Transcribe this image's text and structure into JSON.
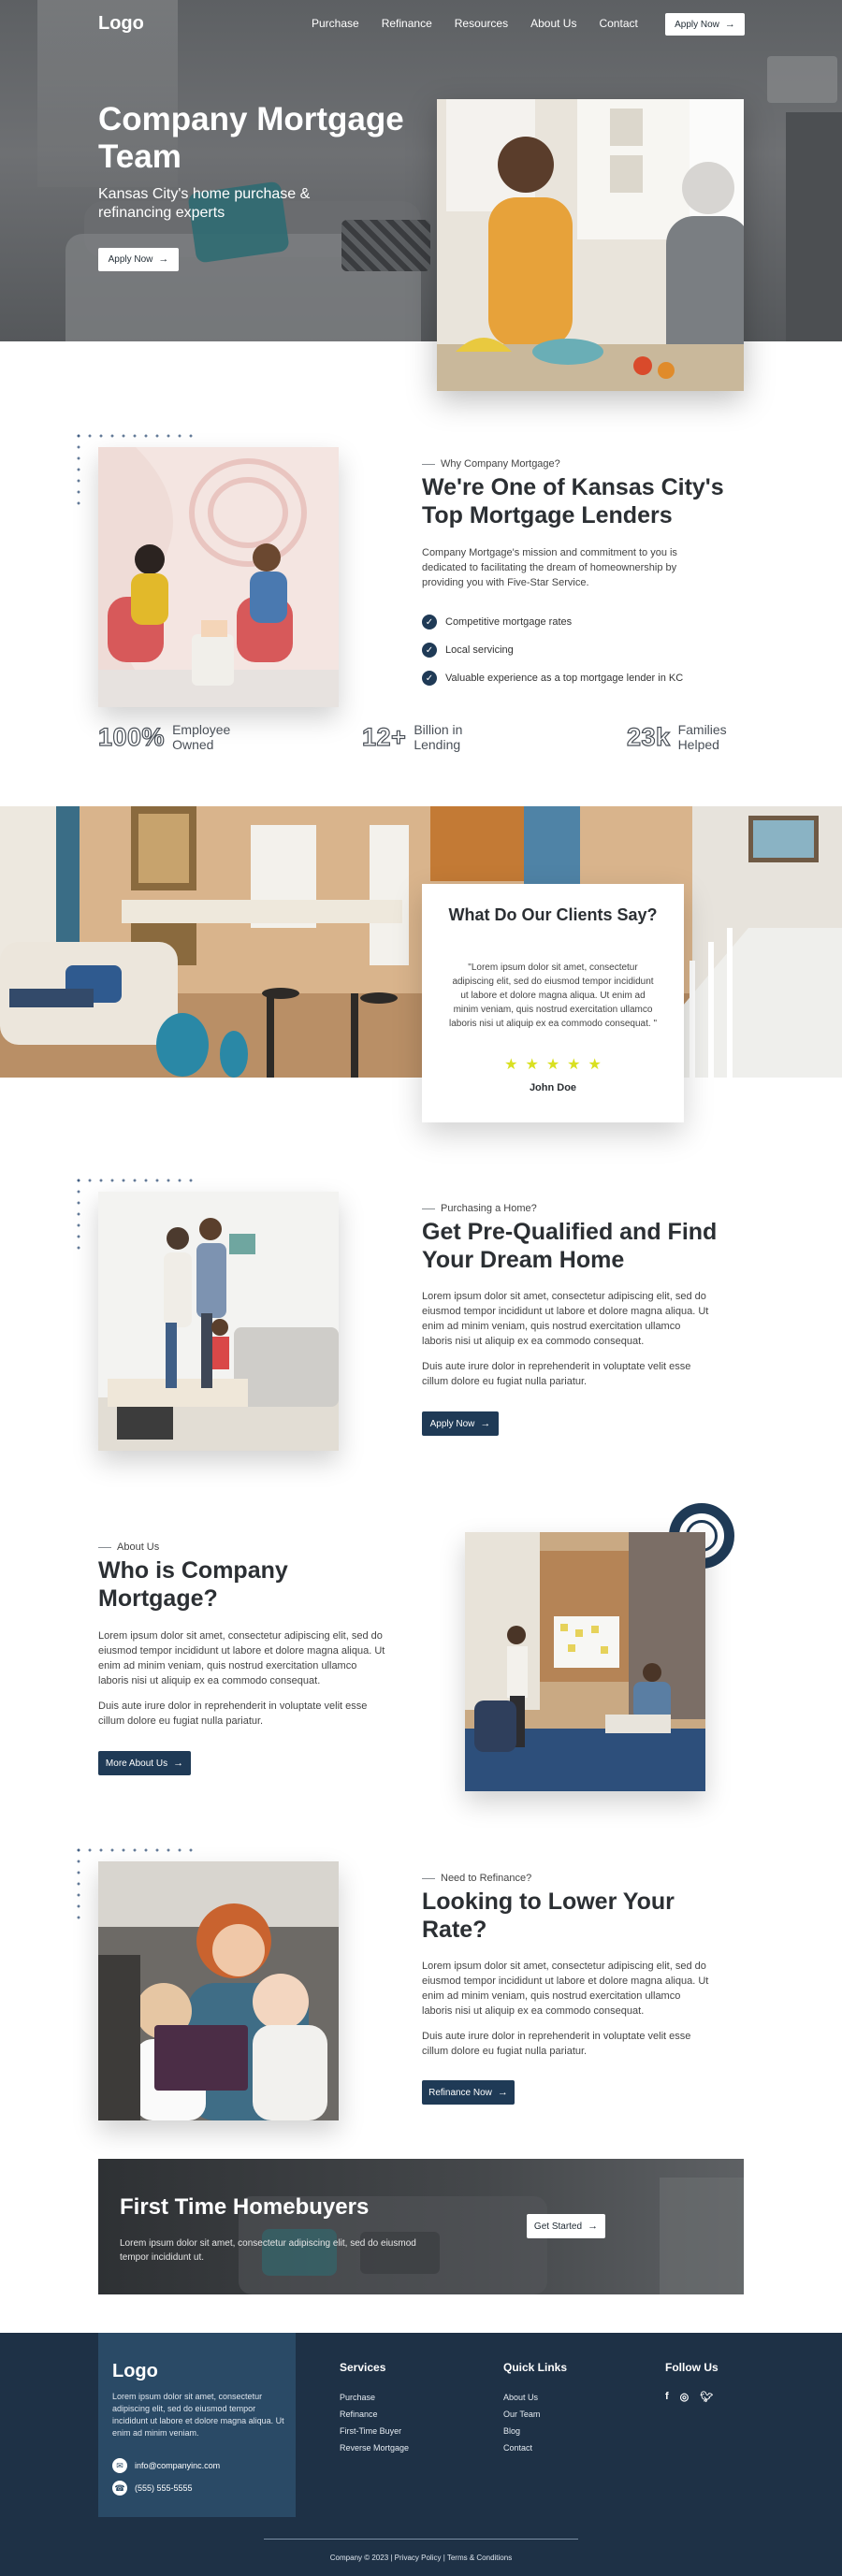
{
  "nav": {
    "logo": "Logo",
    "links": [
      "Purchase",
      "Refinance",
      "Resources",
      "About Us",
      "Contact"
    ],
    "apply_label": "Apply Now"
  },
  "hero": {
    "title": "Company Mortgage Team",
    "subtitle": "Kansas City's home purchase & refinancing experts",
    "button_label": "Apply Now"
  },
  "why": {
    "eyebrow": "Why Company Mortgage?",
    "title": "We're One of Kansas City's Top Mortgage Lenders",
    "text": "Company Mortgage's mission and commitment to you is dedicated to facilitating the dream of homeownership by providing you with Five-Star Service.",
    "checks": [
      "Competitive mortgage rates",
      "Local servicing",
      "Valuable experience as a top mortgage lender in KC"
    ]
  },
  "stats": [
    {
      "value": "100%",
      "label": "Employee Owned"
    },
    {
      "value": "12+",
      "label": "Billion in Lending"
    },
    {
      "value": "23k",
      "label": "Families Helped"
    }
  ],
  "testimonial": {
    "title": "What Do Our Clients Say?",
    "quote": "\"Lorem ipsum dolor sit amet, consectetur adipiscing elit, sed do eiusmod tempor incididunt ut labore et dolore magna aliqua. Ut enim ad minim veniam, quis nostrud exercitation ullamco laboris nisi ut aliquip ex ea commodo consequat. \"",
    "stars": 5,
    "name": "John Doe"
  },
  "prequal": {
    "eyebrow": "Purchasing a Home?",
    "title": "Get Pre-Qualified and Find Your Dream Home",
    "text1": "Lorem ipsum dolor sit amet, consectetur adipiscing elit, sed do eiusmod tempor incididunt ut labore et dolore magna aliqua. Ut enim ad minim veniam, quis nostrud exercitation ullamco laboris nisi ut aliquip ex ea commodo consequat.",
    "text2": "Duis aute irure dolor in reprehenderit in voluptate velit esse cillum dolore eu fugiat nulla pariatur.",
    "button_label": "Apply Now"
  },
  "about": {
    "eyebrow": "About Us",
    "title": "Who is Company Mortgage?",
    "text1": "Lorem ipsum dolor sit amet, consectetur adipiscing elit, sed do eiusmod tempor incididunt ut labore et dolore magna aliqua. Ut enim ad minim veniam, quis nostrud exercitation ullamco laboris nisi ut aliquip ex ea commodo consequat.",
    "text2": "Duis aute irure dolor in reprehenderit in voluptate velit esse cillum dolore eu fugiat nulla pariatur.",
    "button_label": "More About Us"
  },
  "refinance": {
    "eyebrow": "Need to Refinance?",
    "title": "Looking to Lower Your Rate?",
    "text1": "Lorem ipsum dolor sit amet, consectetur adipiscing elit, sed do eiusmod tempor incididunt ut labore et dolore magna aliqua. Ut enim ad minim veniam, quis nostrud exercitation ullamco laboris nisi ut aliquip ex ea commodo consequat.",
    "text2": "Duis aute irure dolor in reprehenderit in voluptate velit esse cillum dolore eu fugiat nulla pariatur.",
    "button_label": "Refinance Now"
  },
  "first_time": {
    "title": "First Time Homebuyers",
    "text": "Lorem ipsum dolor sit amet, consectetur adipiscing elit, sed do eiusmod tempor incididunt ut.",
    "button_label": "Get Started"
  },
  "footer": {
    "logo": "Logo",
    "description": "Lorem ipsum dolor sit amet, consectetur adipiscing elit, sed do eiusmod tempor incididunt ut labore et dolore magna aliqua. Ut enim ad minim veniam.",
    "email": "info@companyinc.com",
    "phone": "(555) 555-5555",
    "services_title": "Services",
    "services": [
      "Purchase",
      "Refinance",
      "First-Time Buyer",
      "Reverse Mortgage"
    ],
    "quick_title": "Quick Links",
    "quick_links": [
      "About Us",
      "Our Team",
      "Blog",
      "Contact"
    ],
    "follow_title": "Follow Us",
    "social_icons": [
      "facebook-icon",
      "instagram-icon",
      "twitter-icon"
    ],
    "copyright": "Company © 2023 | Privacy Policy | Terms & Conditions"
  },
  "colors": {
    "navy": "#1f3a56",
    "footer_bg": "#1e3146",
    "footer_card": "#2a4a66",
    "star": "#d9e021"
  }
}
